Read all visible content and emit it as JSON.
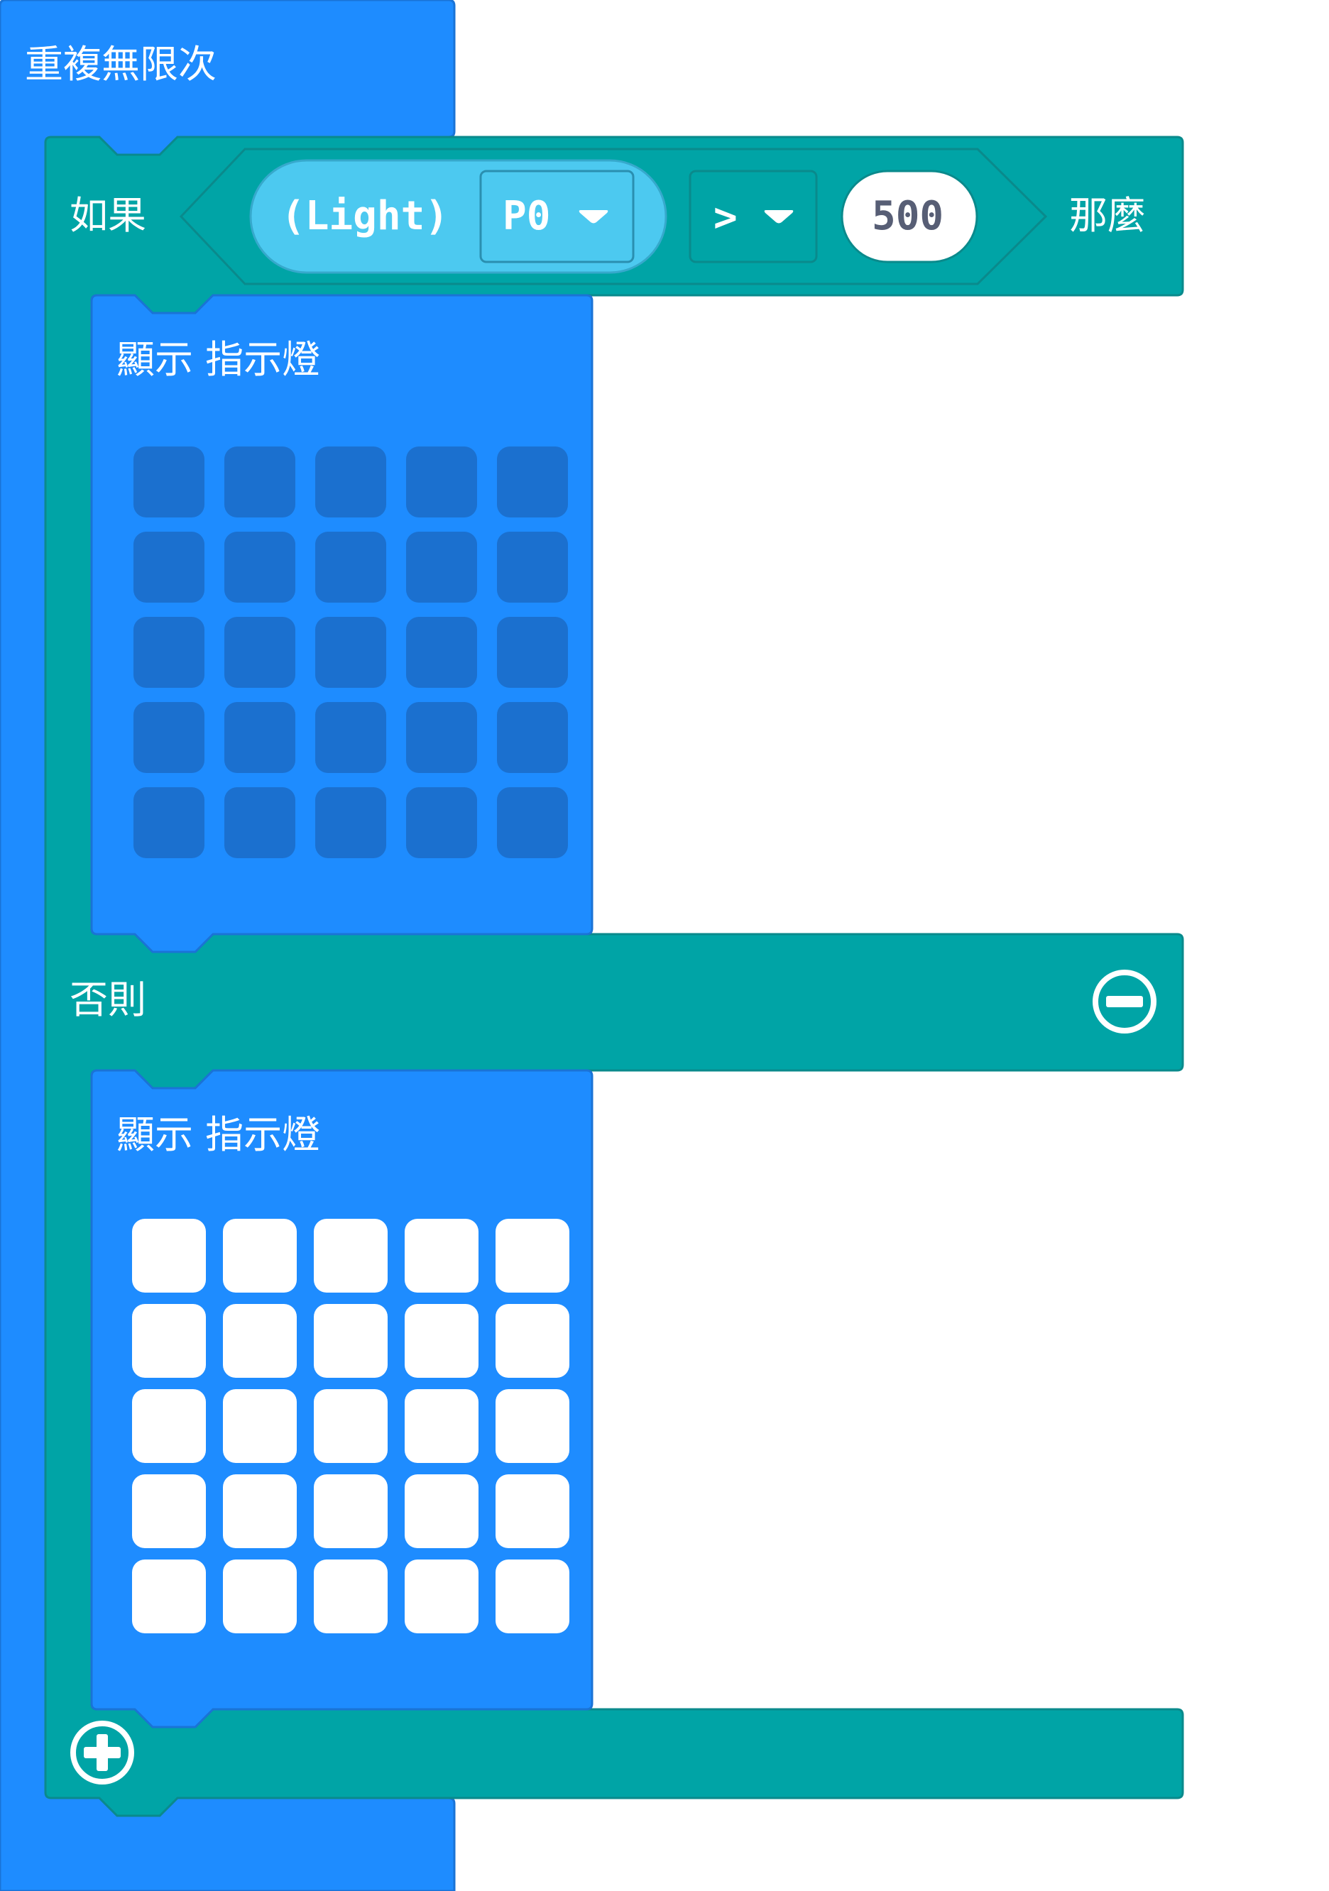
{
  "colors": {
    "loop_block": "#1e8cff",
    "loop_border": "#1a73d6",
    "logic_block": "#00a4a6",
    "logic_border": "#0a8a8c",
    "sensor_pill": "#4cc9f0",
    "led_off": "#1b70cf",
    "led_on": "#ffffff"
  },
  "loop": {
    "label": "重複無限次"
  },
  "if_block": {
    "if_label": "如果",
    "then_label": "那麼",
    "else_label": "否則",
    "condition": {
      "sensor_text": "(Light)",
      "pin_value": "P0",
      "operator": ">",
      "threshold": "500"
    },
    "remove_icon": "minus-circle-icon",
    "add_icon": "plus-circle-icon"
  },
  "show_leds_then": {
    "label": "顯示  指示燈",
    "grid": [
      [
        0,
        0,
        0,
        0,
        0
      ],
      [
        0,
        0,
        0,
        0,
        0
      ],
      [
        0,
        0,
        0,
        0,
        0
      ],
      [
        0,
        0,
        0,
        0,
        0
      ],
      [
        0,
        0,
        0,
        0,
        0
      ]
    ]
  },
  "show_leds_else": {
    "label": "顯示  指示燈",
    "grid": [
      [
        1,
        1,
        1,
        1,
        1
      ],
      [
        1,
        1,
        1,
        1,
        1
      ],
      [
        1,
        1,
        1,
        1,
        1
      ],
      [
        1,
        1,
        1,
        1,
        1
      ],
      [
        1,
        1,
        1,
        1,
        1
      ]
    ]
  }
}
